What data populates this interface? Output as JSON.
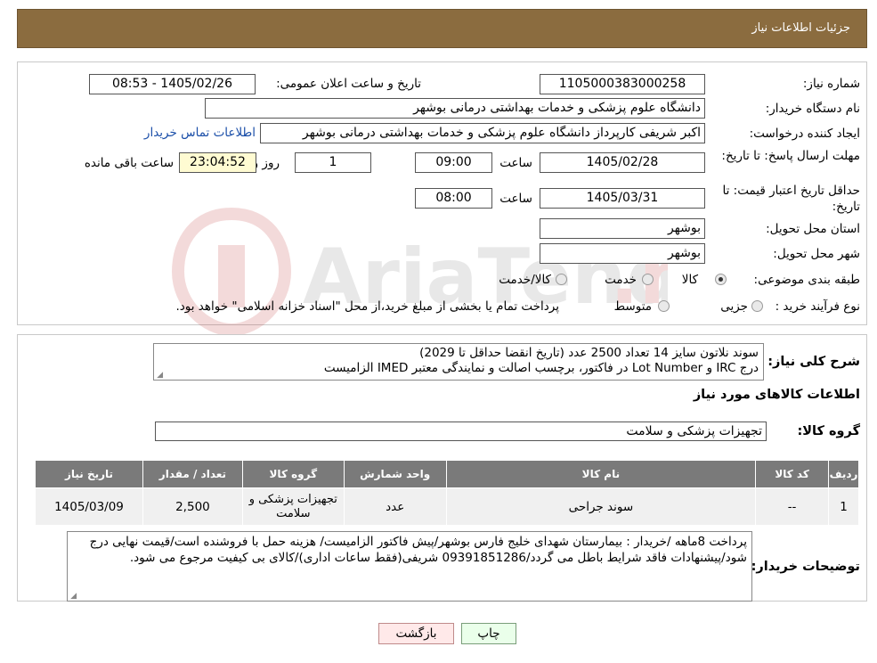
{
  "header": {
    "title": "جزئیات اطلاعات نیاز"
  },
  "form": {
    "need_number_label": "شماره نیاز:",
    "need_number": "1105000383000258",
    "announce_label": "تاریخ و ساعت اعلان عمومی:",
    "announce_value": "1405/02/26 - 08:53",
    "buyer_label": "نام دستگاه خریدار:",
    "buyer_value": "دانشگاه علوم پزشکی و خدمات بهداشتی درمانی بوشهر",
    "creator_label": "ایجاد کننده درخواست:",
    "creator_value": "اکبر شریفی کارپرداز دانشگاه علوم پزشکی و خدمات بهداشتی درمانی بوشهر",
    "contact_link": "اطلاعات تماس خریدار",
    "deadline_label": "مهلت ارسال پاسخ: تا تاریخ:",
    "deadline_date": "1405/02/28",
    "time_label": "ساعت",
    "deadline_time": "09:00",
    "days_value": "1",
    "days_label": "روز و",
    "remaining_time": "23:04:52",
    "remaining_label": "ساعت باقی مانده",
    "validity_label": "حداقل تاریخ اعتبار قیمت: تا تاریخ:",
    "validity_date": "1405/03/31",
    "validity_time": "08:00",
    "province_label": "استان محل تحویل:",
    "province_value": "بوشهر",
    "city_label": "شهر محل تحویل:",
    "city_value": "بوشهر",
    "category_label": "طبقه بندی موضوعی:",
    "category_options": [
      "کالا",
      "خدمت",
      "کالا/خدمت"
    ],
    "category_selected": "کالا",
    "process_label": "نوع فرآیند خرید :",
    "process_options": [
      "جزیی",
      "متوسط"
    ],
    "process_note": "پرداخت تمام یا بخشی از مبلغ خرید،از محل \"اسناد خزانه اسلامی\" خواهد بود."
  },
  "summary": {
    "label": "شرح کلی نیاز:",
    "line1": "سوند نلاتون سایز 14 تعداد 2500 عدد (تاریخ انقضا حداقل تا 2029)",
    "line2": "درج IRC و Lot Number در فاکتور، برچسب اصالت و نمایندگی معتبر IMED الزامیست"
  },
  "goods": {
    "section_title": "اطلاعات کالاهای مورد نیاز",
    "group_label": "گروه کالا:",
    "group_value": "تجهیزات پزشکی و سلامت",
    "columns": [
      "ردیف",
      "کد کالا",
      "نام کالا",
      "واحد شمارش",
      "گروه کالا",
      "تعداد / مقدار",
      "تاریخ نیاز"
    ],
    "rows": [
      {
        "row": "1",
        "code": "--",
        "name": "سوند جراحی",
        "unit": "عدد",
        "group": "تجهیزات پزشکی و سلامت",
        "qty": "2,500",
        "date": "1405/03/09"
      }
    ]
  },
  "notes": {
    "label": "توضیحات خریدار:",
    "text": "پرداخت 8ماهه /خریدار : بیمارستان شهدای خلیج فارس بوشهر/پیش فاکتور الزامیست/ هزینه حمل با فروشنده است/قیمت نهایی درج شود/پیشنهادات فاقد شرایط باطل می گردد/09391851286 شریفی(فقط ساعات اداری)/کالای بی کیفیت مرجوع می شود."
  },
  "buttons": {
    "print": "چاپ",
    "back": "بازگشت"
  },
  "colors": {
    "header": "#8b6c3f",
    "table_header": "#7a7a7a",
    "print_bg": "#eaffea",
    "back_bg": "#ffe9e9"
  }
}
